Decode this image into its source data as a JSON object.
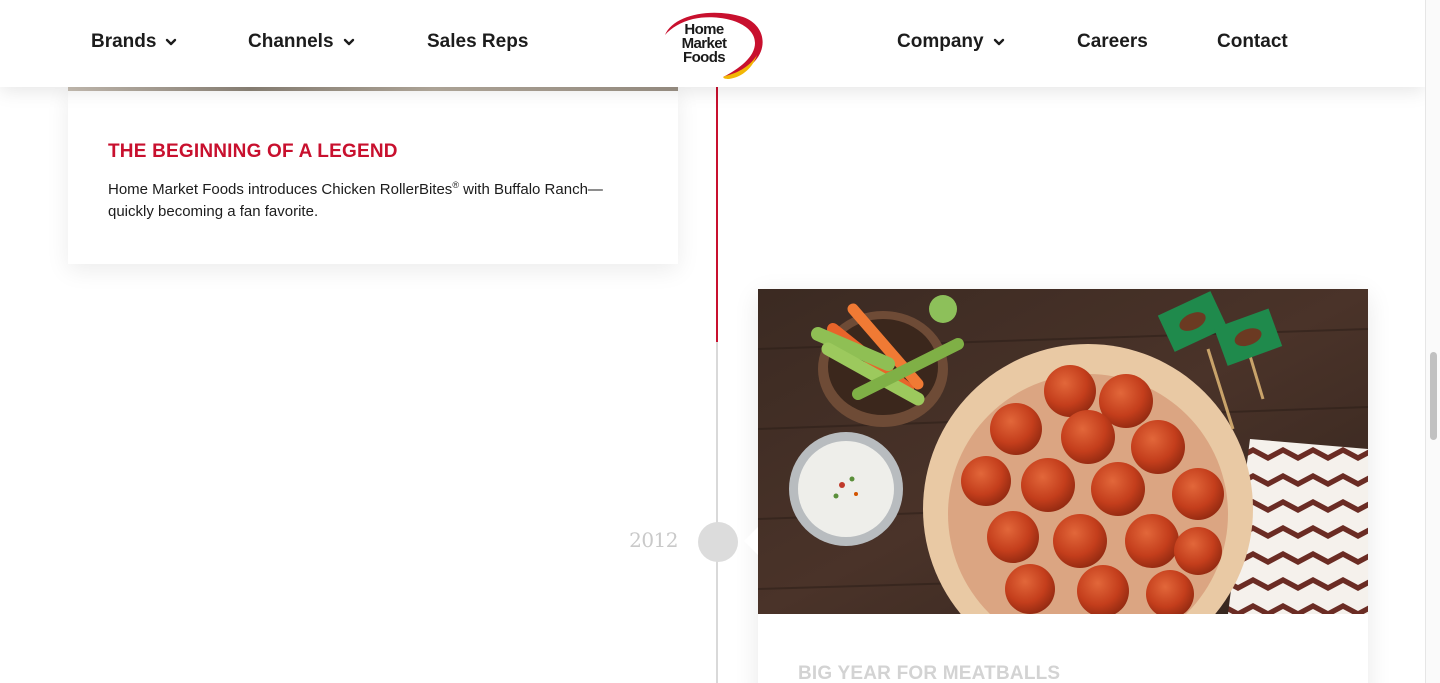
{
  "header": {
    "nav_left": [
      {
        "label": "Brands",
        "has_dropdown": true
      },
      {
        "label": "Channels",
        "has_dropdown": true
      },
      {
        "label": "Sales Reps",
        "has_dropdown": false
      }
    ],
    "logo_text": [
      "Home",
      "Market",
      "Foods"
    ],
    "nav_right": [
      {
        "label": "Company",
        "has_dropdown": true
      },
      {
        "label": "Careers",
        "has_dropdown": false
      },
      {
        "label": "Contact",
        "has_dropdown": false
      }
    ]
  },
  "timeline": {
    "entries": [
      {
        "title": "THE BEGINNING OF A LEGEND",
        "body_pre": "Home Market Foods introduces Chicken RollerBites",
        "body_sup": "®",
        "body_post": " with Buffalo Ranch—quickly becoming a fan favorite."
      },
      {
        "year": "2012",
        "title": "BIG YEAR FOR MEATBALLS",
        "image": "meatballs-with-celery-carrots-ranch-dip-photo"
      }
    ]
  },
  "colors": {
    "brand_red": "#c8102e",
    "brand_yellow": "#f2b705",
    "timeline_grey": "#d9d9d9",
    "year_grey": "#c9c9c9"
  }
}
